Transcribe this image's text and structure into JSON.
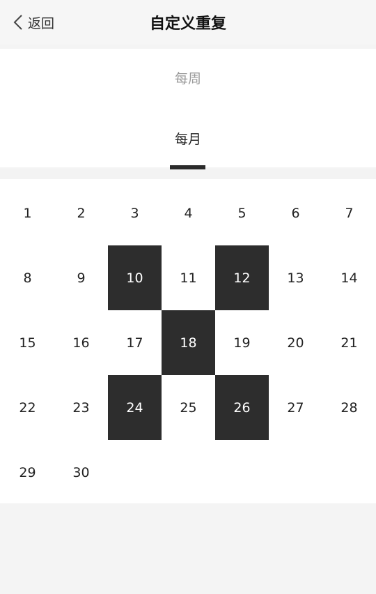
{
  "header": {
    "back_label": "返回",
    "title": "自定义重复"
  },
  "mode": {
    "options": [
      "每周",
      "每月"
    ],
    "selected": "每月"
  },
  "calendar": {
    "days": [
      {
        "label": "1",
        "selected": false
      },
      {
        "label": "2",
        "selected": false
      },
      {
        "label": "3",
        "selected": false
      },
      {
        "label": "4",
        "selected": false
      },
      {
        "label": "5",
        "selected": false
      },
      {
        "label": "6",
        "selected": false
      },
      {
        "label": "7",
        "selected": false
      },
      {
        "label": "8",
        "selected": false
      },
      {
        "label": "9",
        "selected": false
      },
      {
        "label": "10",
        "selected": true
      },
      {
        "label": "11",
        "selected": false
      },
      {
        "label": "12",
        "selected": true
      },
      {
        "label": "13",
        "selected": false
      },
      {
        "label": "14",
        "selected": false
      },
      {
        "label": "15",
        "selected": false
      },
      {
        "label": "16",
        "selected": false
      },
      {
        "label": "17",
        "selected": false
      },
      {
        "label": "18",
        "selected": true
      },
      {
        "label": "19",
        "selected": false
      },
      {
        "label": "20",
        "selected": false
      },
      {
        "label": "21",
        "selected": false
      },
      {
        "label": "22",
        "selected": false
      },
      {
        "label": "23",
        "selected": false
      },
      {
        "label": "24",
        "selected": true
      },
      {
        "label": "25",
        "selected": false
      },
      {
        "label": "26",
        "selected": true
      },
      {
        "label": "27",
        "selected": false
      },
      {
        "label": "28",
        "selected": false
      },
      {
        "label": "29",
        "selected": false
      },
      {
        "label": "30",
        "selected": false
      }
    ]
  },
  "colors": {
    "selected_bg": "#2d2d2d",
    "selected_text": "#ffffff",
    "inactive_mode_text": "#9a9a9a"
  }
}
